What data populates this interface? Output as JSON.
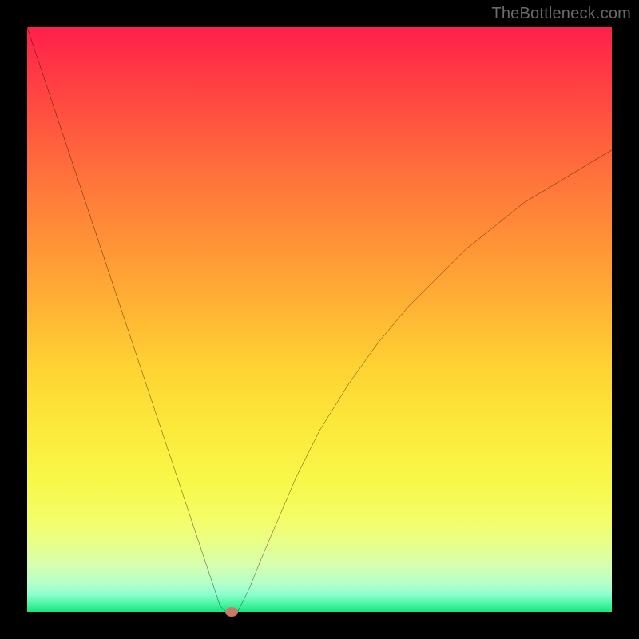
{
  "watermark": "TheBottleneck.com",
  "chart_data": {
    "type": "line",
    "title": "",
    "xlabel": "",
    "ylabel": "",
    "xlim": [
      0,
      100
    ],
    "ylim": [
      0,
      100
    ],
    "grid": false,
    "legend": false,
    "background_gradient": {
      "direction": "vertical",
      "stops": [
        {
          "pos": 0,
          "color": "#ff1f4b"
        },
        {
          "pos": 50,
          "color": "#ffd233"
        },
        {
          "pos": 80,
          "color": "#f8f84a"
        },
        {
          "pos": 100,
          "color": "#17e57f"
        }
      ]
    },
    "series": [
      {
        "name": "bottleneck-curve",
        "color": "#000000",
        "x": [
          0,
          2,
          4,
          6,
          8,
          10,
          12,
          14,
          16,
          18,
          20,
          22,
          24,
          26,
          28,
          30,
          32,
          33,
          34,
          35,
          36,
          38,
          40,
          43,
          46,
          50,
          55,
          60,
          65,
          70,
          75,
          80,
          85,
          90,
          95,
          100
        ],
        "y": [
          100,
          94,
          88,
          82,
          76,
          70,
          64,
          58,
          52,
          46,
          40,
          34,
          28,
          22,
          16,
          10,
          4,
          1,
          0,
          0,
          0,
          4,
          9,
          16,
          23,
          31,
          39,
          46,
          52,
          57,
          62,
          66,
          70,
          73,
          76,
          79
        ]
      }
    ],
    "marker": {
      "name": "optimal-point",
      "x": 35,
      "y": 0,
      "color": "#c97a66"
    }
  }
}
